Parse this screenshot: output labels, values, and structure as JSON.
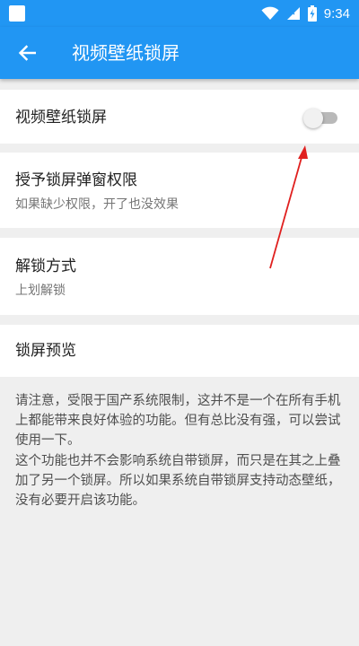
{
  "status_bar": {
    "time": "9:34"
  },
  "app_bar": {
    "title": "视频壁纸锁屏"
  },
  "settings": {
    "video_lockscreen": {
      "title": "视频壁纸锁屏",
      "enabled": false
    },
    "popup_permission": {
      "title": "授予锁屏弹窗权限",
      "subtitle": "如果缺少权限，开了也没效果"
    },
    "unlock_method": {
      "title": "解锁方式",
      "subtitle": "上划解锁"
    },
    "preview": {
      "title": "锁屏预览"
    }
  },
  "note": {
    "para1": "请注意，受限于国产系统限制，这并不是一个在所有手机上都能带来良好体验的功能。但有总比没有强，可以尝试使用一下。",
    "para2": "这个功能也并不会影响系统自带锁屏，而只是在其之上叠加了另一个锁屏。所以如果系统自带锁屏支持动态壁纸，没有必要开启该功能。"
  },
  "colors": {
    "primary": "#2196f3",
    "annotation": "#e0201f"
  }
}
